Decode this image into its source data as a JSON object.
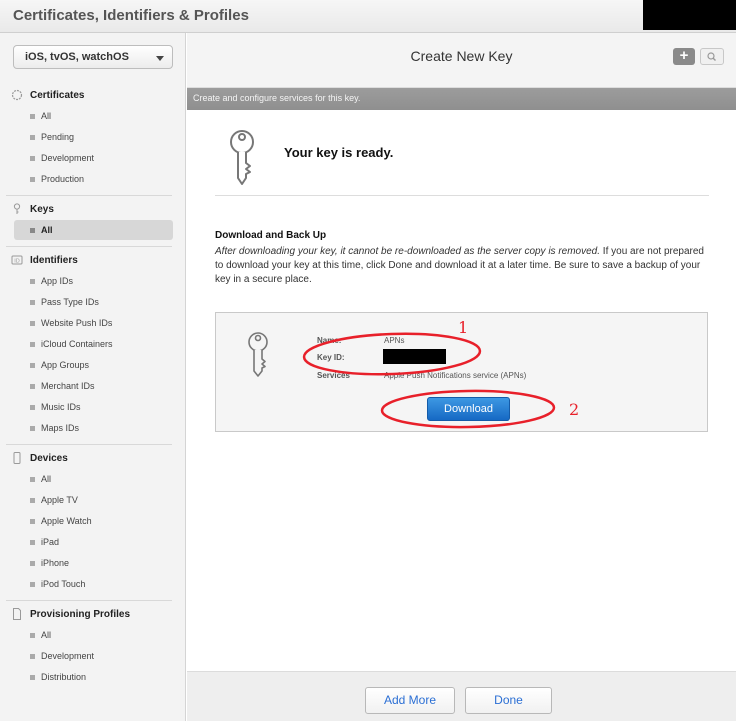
{
  "app": {
    "title": "Certificates, Identifiers & Profiles"
  },
  "sidebar": {
    "platform": "iOS, tvOS, watchOS",
    "sections": {
      "certificates": {
        "title": "Certificates",
        "items": [
          "All",
          "Pending",
          "Development",
          "Production"
        ]
      },
      "keys": {
        "title": "Keys",
        "items": [
          "All"
        ]
      },
      "identifiers": {
        "title": "Identifiers",
        "items": [
          "App IDs",
          "Pass Type IDs",
          "Website Push IDs",
          "iCloud Containers",
          "App Groups",
          "Merchant IDs",
          "Music IDs",
          "Maps IDs"
        ]
      },
      "devices": {
        "title": "Devices",
        "items": [
          "All",
          "Apple TV",
          "Apple Watch",
          "iPad",
          "iPhone",
          "iPod Touch"
        ]
      },
      "profiles": {
        "title": "Provisioning Profiles",
        "items": [
          "All",
          "Development",
          "Distribution"
        ]
      }
    },
    "selected": "keys.all"
  },
  "main": {
    "title": "Create New Key",
    "subtitle": "Create and configure services for this key.",
    "hero": "Your key is ready.",
    "download_section": {
      "title": "Download and Back Up",
      "body_italic": "After downloading your key, it cannot be re-downloaded as the server copy is removed.",
      "body_rest": " If you are not prepared to download your key at this time, click Done and download it at a later time. Be sure to save a backup of your key in a secure place."
    },
    "key_card": {
      "name_label": "Name:",
      "name_value": "APNs",
      "key_id_label": "Key ID:",
      "services_label": "Services",
      "services_value": "Apple Push Notifications service (APNs)",
      "download_label": "Download"
    },
    "footer": {
      "add_more_label": "Add More",
      "done_label": "Done"
    }
  },
  "annotations": {
    "marker_1": "1",
    "marker_2": "2",
    "color": "#e8202a"
  },
  "colors": {
    "accent": "#1a73c9",
    "link": "#2b6fd4",
    "subbar": "#969696"
  },
  "icons": {
    "key": "key-icon",
    "add": "plus-icon",
    "search": "search-icon"
  }
}
